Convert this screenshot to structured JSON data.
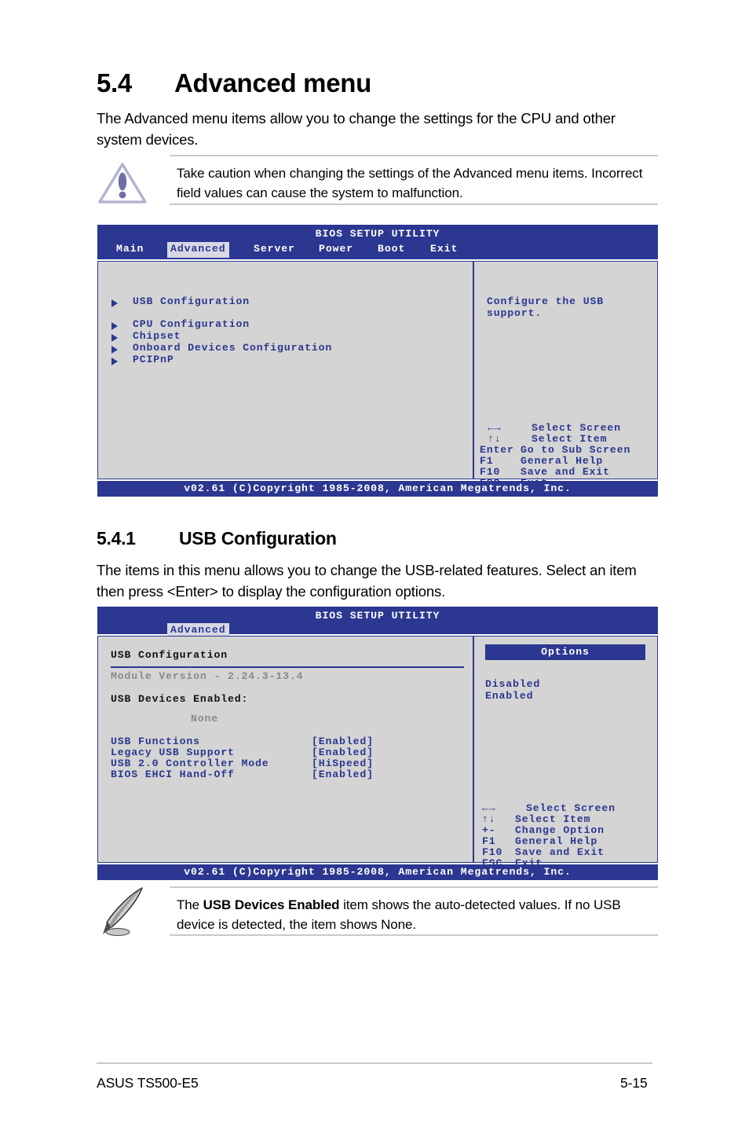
{
  "document": {
    "section": {
      "number": "5.4",
      "title": "Advanced menu",
      "intro": "The Advanced menu items allow you to change the settings for the CPU and other system devices."
    },
    "warning_callout": {
      "icon": "warning-triangle-icon",
      "text": "Take caution when changing the settings of the Advanced menu items. Incorrect field values can cause the system to malfunction."
    },
    "subsection": {
      "number": "5.4.1",
      "title": "USB Configuration",
      "intro": "The items in this menu allows you to change the USB-related features. Select an item then press <Enter> to display the configuration options."
    },
    "note_callout": {
      "icon": "quill-pen-icon",
      "text_before": "The ",
      "text_bold": "USB Devices Enabled",
      "text_after": " item shows the auto-detected values. If no USB device is detected, the item shows None."
    },
    "footer": {
      "product": "ASUS TS500-E5",
      "page_number": "5-15"
    }
  },
  "bios_screen_1": {
    "title": "BIOS SETUP UTILITY",
    "tabs": [
      {
        "label": "Main",
        "active": false
      },
      {
        "label": "Advanced",
        "active": true
      },
      {
        "label": "Server",
        "active": false
      },
      {
        "label": "Power",
        "active": false
      },
      {
        "label": "Boot",
        "active": false
      },
      {
        "label": "Exit",
        "active": false
      }
    ],
    "menu_items": [
      "USB Configuration",
      "CPU Configuration",
      "Chipset",
      "Onboard Devices Configuration",
      "PCIPnP"
    ],
    "help_text_line1": "Configure the USB",
    "help_text_line2": "support.",
    "key_legend": [
      {
        "key": "←→",
        "action": "Select Screen"
      },
      {
        "key": "↑↓",
        "action": "Select Item"
      },
      {
        "key": "Enter",
        "action": "Go to Sub Screen"
      },
      {
        "key": "F1",
        "action": "General Help"
      },
      {
        "key": "F10",
        "action": "Save and Exit"
      },
      {
        "key": "ESC",
        "action": "Exit"
      }
    ],
    "footer": "v02.61 (C)Copyright 1985-2008, American Megatrends, Inc."
  },
  "bios_screen_2": {
    "title": "BIOS SETUP UTILITY",
    "tabs": [
      {
        "label": "Advanced",
        "active": true
      }
    ],
    "panel_heading": "USB Configuration",
    "module_version": "Module Version - 2.24.3-13.4",
    "devices_enabled_label": "USB Devices Enabled:",
    "devices_enabled_value": "None",
    "settings": [
      {
        "label": "USB Functions",
        "value": "[Enabled]"
      },
      {
        "label": "Legacy USB Support",
        "value": "[Enabled]"
      },
      {
        "label": "USB 2.0 Controller Mode",
        "value": "[HiSpeed]"
      },
      {
        "label": "BIOS EHCI Hand-Off",
        "value": "[Enabled]"
      }
    ],
    "options_header": "Options",
    "options": [
      "Disabled",
      "Enabled"
    ],
    "key_legend": [
      {
        "key": "←→",
        "action": "Select Screen"
      },
      {
        "key": "↑↓",
        "action": "Select Item"
      },
      {
        "key": "+-",
        "action": "Change Option"
      },
      {
        "key": "F1",
        "action": "General Help"
      },
      {
        "key": "F10",
        "action": "Save and Exit"
      },
      {
        "key": "ESC",
        "action": "Exit"
      }
    ],
    "footer": "v02.61 (C)Copyright 1985-2008, American Megatrends, Inc."
  },
  "colors": {
    "bios_blue": "#2b3790",
    "panel_gray": "#d4d4d4",
    "tab_active_bg": "#d8d8e4",
    "gray_text": "#8a8a8a",
    "rule_gray": "#c9c9c9",
    "warning_purple": "#7b7bb0"
  }
}
